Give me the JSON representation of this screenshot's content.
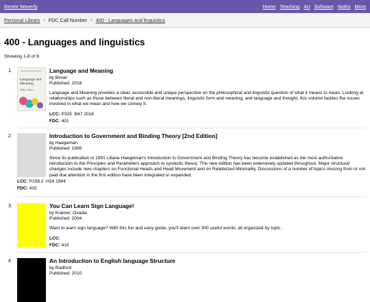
{
  "topbar": {
    "site_name": "Renée Waverly",
    "nav": [
      "Home",
      "Teaching",
      "Art",
      "Software",
      "Notes",
      "More"
    ]
  },
  "breadcrumb": {
    "items": [
      "Personal Library",
      "FDC Call Number",
      "400 - Languages and linguistics"
    ]
  },
  "page": {
    "title": "400 - Languages and linguistics",
    "showing": "Showing 1-8 of 8"
  },
  "items": [
    {
      "number": "1.",
      "title": "Language and Meaning",
      "by": "by Birner",
      "published": "Published: 2018",
      "description": "Language and Meaning provides a clear, accessible and unique perspective on the philosophical and linguistic question of what it means to mean. Looking at relationships such as those between literal and non-literal meanings, linguistic form and meaning, and language and thought, this volume tackles the issues involved in what we mean and how we convey it.",
      "lcc_label": "LCC:",
      "lcc": "P325 .B47 2018",
      "fdc_label": "FDC:",
      "fdc": "401",
      "cover_title": "Language and Meaning",
      "cover_author": "Betty J. Birner"
    },
    {
      "number": "2.",
      "title": "Introduction to Government and Binding Theory [2nd Edition]",
      "by": "by Haegeman",
      "published": "Published: 1999",
      "description": "Since its publication in 1991 Liliane Haegeman's Introduction to Government and Binding Theory has become established as the most authoritative introduction to the Principles and Parameters approach to syntactic theory. This new edition has been extensively updated throughout. Major structural changes include new chapters on Functional Heads and Head Movement and on Relativized Minimality. Discussions of a number of topics missing from or not paid due attention in the first edition have been integrated or expanded.",
      "lcc_label": "LCC:",
      "lcc": "P158.2 .H34 1994",
      "fdc_label": "FDC:",
      "fdc": "415"
    },
    {
      "number": "3.",
      "title": "You Can Learn Sign Language!",
      "by": "by Kramer; Ovadia",
      "published": "Published: 2004",
      "description": "Want to learn sign language? With this fun and easy guide, you'll learn over 300 useful words, all organized by topic.",
      "lcc_label": "LCC:",
      "lcc": "",
      "fdc_label": "FDC:",
      "fdc": "419"
    },
    {
      "number": "4.",
      "title": "An Introduction to English language Structure",
      "by": "by Radford",
      "published": "Published: 2010"
    }
  ],
  "colors": {
    "topbar": "#6c56a7",
    "cover2": "#dcdcdc",
    "cover3": "#ffff00",
    "cover4": "#000000"
  }
}
